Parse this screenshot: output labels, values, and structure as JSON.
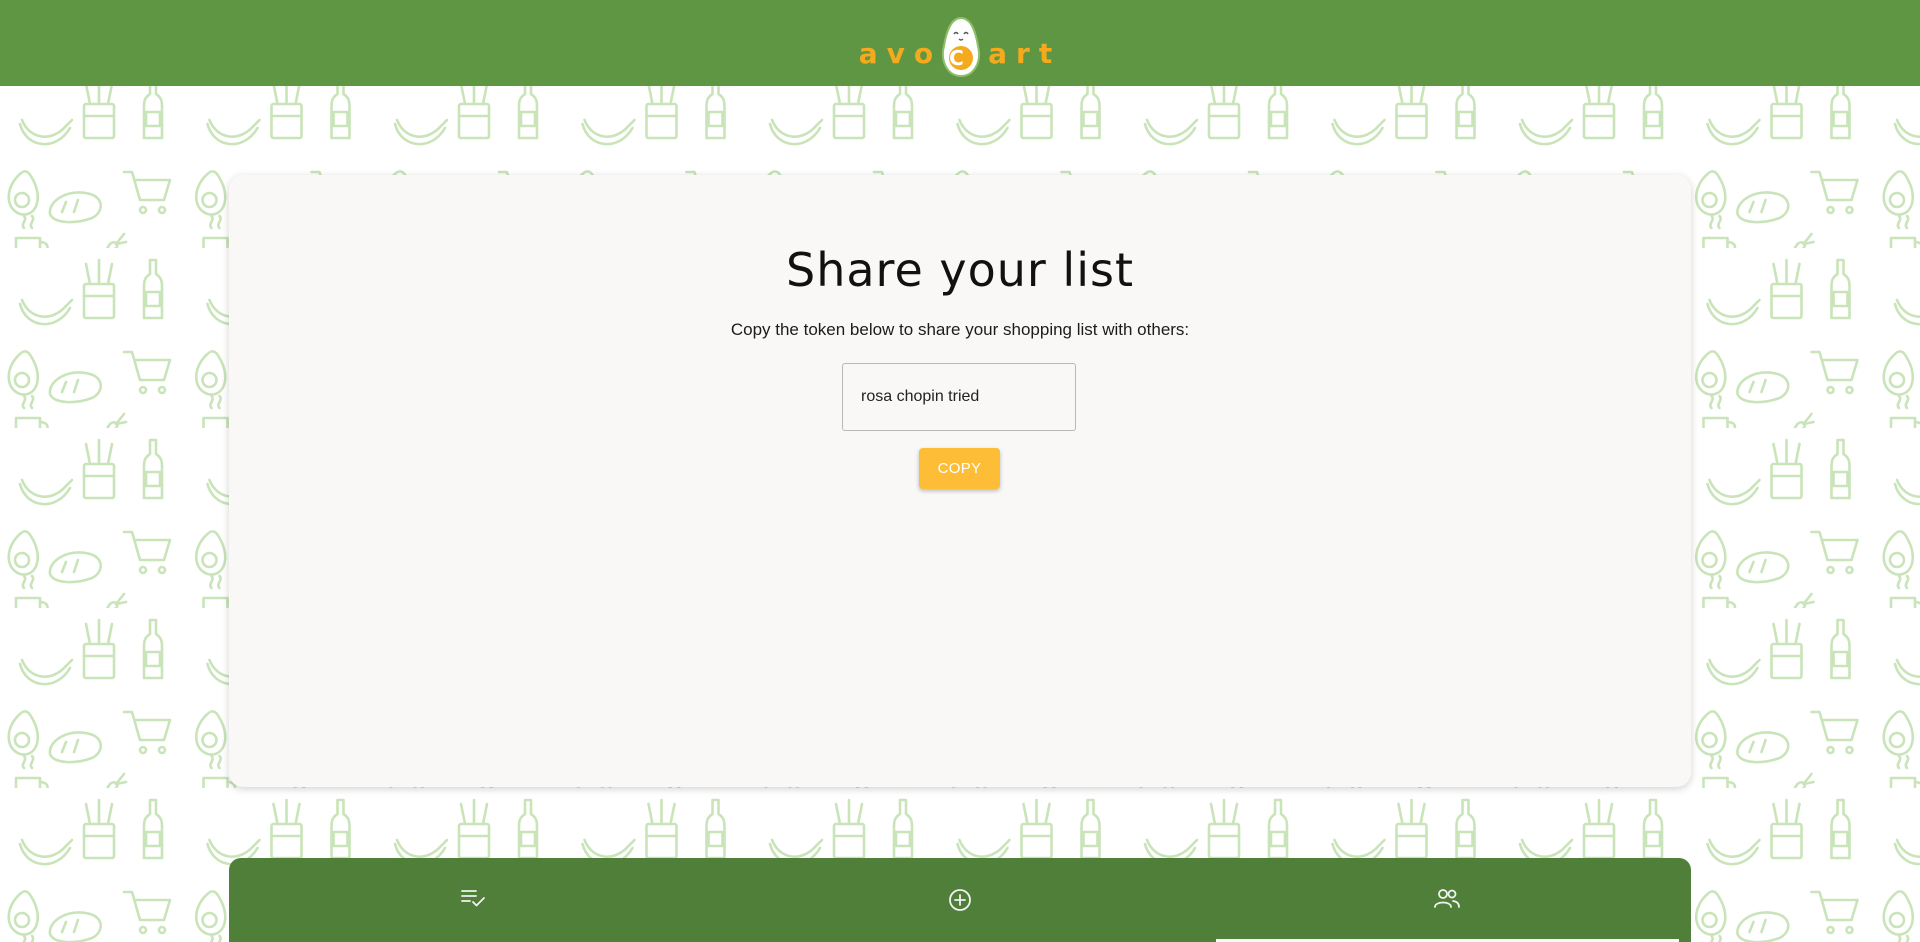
{
  "header": {
    "logo_text_left": "avo",
    "logo_letter": "C",
    "logo_text_right": "art",
    "bg_color": "#5f9644",
    "logo_color": "#f4aa1c"
  },
  "share": {
    "title": "Share your list",
    "description": "Copy the token below to share your shopping list with others:",
    "token_value": "rosa chopin tried",
    "copy_label": "COPY"
  },
  "bottom_nav": {
    "bg_color": "#4f7f38",
    "items": [
      {
        "icon": "list-check-icon",
        "active": false
      },
      {
        "icon": "add-circle-icon",
        "active": false
      },
      {
        "icon": "people-icon",
        "active": true
      }
    ]
  },
  "colors": {
    "accent": "#fdbd36",
    "pattern": "#c9e4b9"
  }
}
